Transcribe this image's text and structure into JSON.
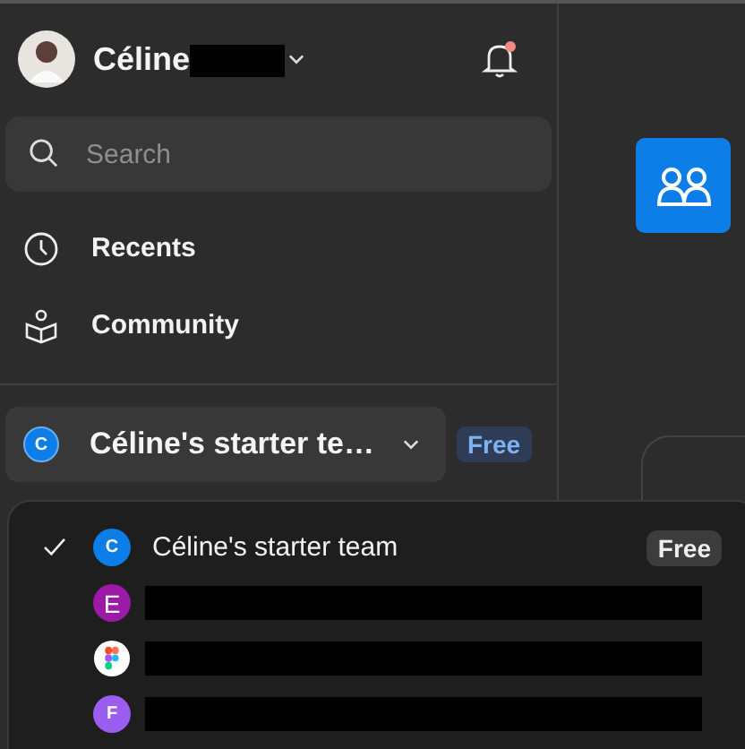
{
  "header": {
    "user_name": "Céline",
    "name_redacted": true,
    "notification_unread": true
  },
  "search": {
    "placeholder": "Search"
  },
  "nav": [
    {
      "kind": "clock",
      "label": "Recents"
    },
    {
      "kind": "community",
      "label": "Community"
    }
  ],
  "team_switcher": {
    "initial": "C",
    "color": "#0d7de8",
    "name": "Céline's starter te…",
    "badge": "Free"
  },
  "team_menu": [
    {
      "kind": "letter",
      "initial": "C",
      "color": "#0d7de8",
      "name": "Céline's starter team",
      "badge": "Free",
      "selected": true,
      "redacted": false
    },
    {
      "kind": "letter",
      "initial": "E",
      "color": "#9c1aa6",
      "selected": false,
      "redacted": true
    },
    {
      "kind": "logo",
      "selected": false,
      "redacted": true
    },
    {
      "kind": "letter",
      "initial": "F",
      "color": "#9b5cf0",
      "selected": false,
      "redacted": true
    }
  ]
}
